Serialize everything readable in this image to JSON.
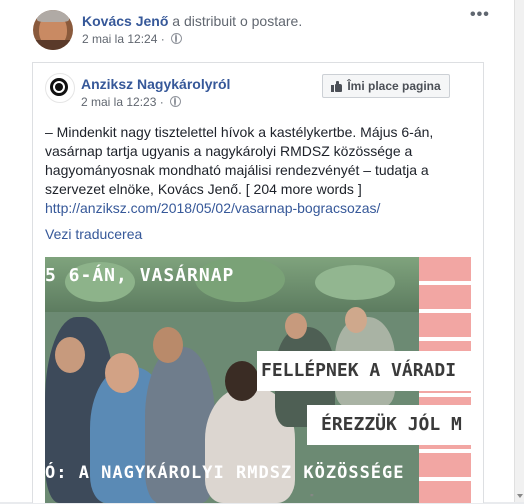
{
  "post": {
    "author": "Kovács Jenő",
    "action": " a distribuit o postare.",
    "date": "2 mai la 12:24",
    "separator": " · ",
    "more_icon": "•••"
  },
  "shared": {
    "page_name": "Anziksz Nagykárolyról",
    "date": "2 mai la 12:23",
    "separator": " · ",
    "like_button": "Îmi place pagina",
    "text": "– Mindenkit nagy tisztelettel hívok a kastélykertbe. Május 6-án, vasárnap tartja ugyanis a nagykárolyi RMDSZ közössége a hagyományosnak mondható majálisi rendezvényét – tudatja a szervezet elnöke, Kovács Jenő. [ 204 more words ]",
    "link": "http://anziksz.com/2018/05/02/vasarnap-bogracsozas/",
    "translate": "Vezi traducerea"
  },
  "image": {
    "top_text": "5 6-ÁN, VASÁRNAP",
    "banner1": "FELLÉPNEK A VÁRADI",
    "banner2": "ÉREZZÜK JÓL M",
    "bottom_text": "Ó: A NAGYKÁROLYI RMDSZ KÖZÖSSÉGE"
  },
  "scroll_marker": "'''",
  "colors": {
    "link": "#365899",
    "pink": "#f2a6a3"
  }
}
